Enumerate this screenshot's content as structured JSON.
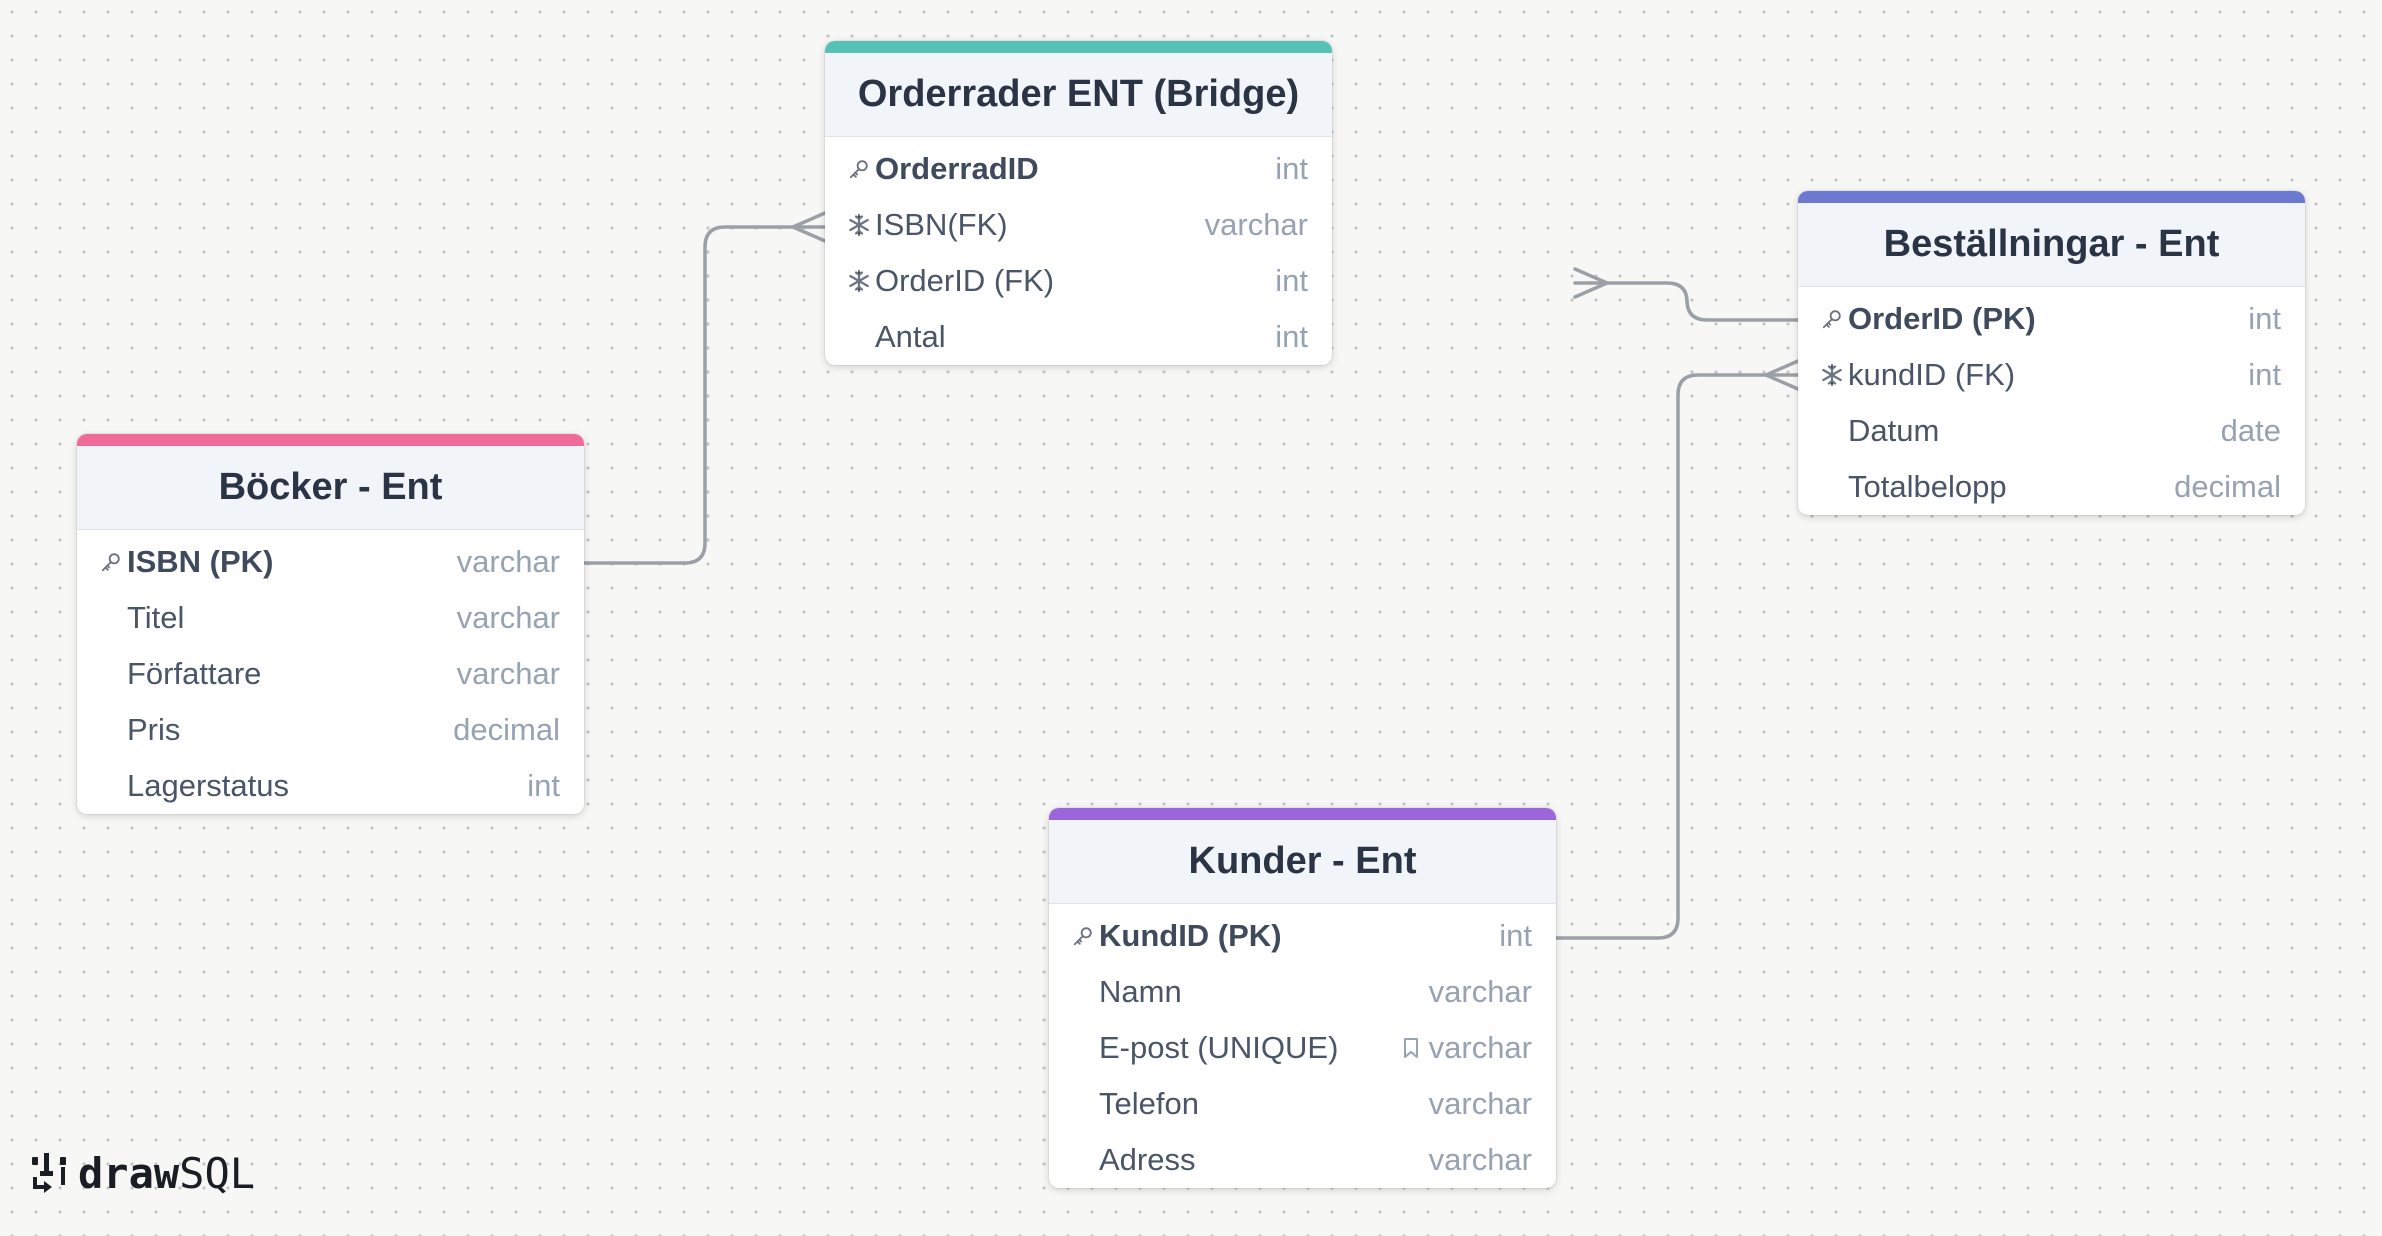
{
  "colors": {
    "orderrader": "#56c2b4",
    "bestallningar": "#6c79d1",
    "bocker": "#ef6b99",
    "kunder": "#9b65dc",
    "connector": "#9aa0a6"
  },
  "tables": {
    "orderrader": {
      "title": "Orderrader ENT (Bridge)",
      "fields": [
        {
          "name": "OrderradID",
          "type": "int",
          "icon": "key-icon"
        },
        {
          "name": "ISBN(FK)",
          "type": "varchar",
          "icon": "snowflake-icon"
        },
        {
          "name": "OrderID (FK)",
          "type": "int",
          "icon": "snowflake-icon"
        },
        {
          "name": "Antal",
          "type": "int",
          "icon": ""
        }
      ]
    },
    "bestallningar": {
      "title": "Beställningar - Ent",
      "fields": [
        {
          "name": "OrderID (PK)",
          "type": "int",
          "icon": "key-icon"
        },
        {
          "name": "kundID (FK)",
          "type": "int",
          "icon": "snowflake-icon"
        },
        {
          "name": "Datum",
          "type": "date",
          "icon": ""
        },
        {
          "name": "Totalbelopp",
          "type": "decimal",
          "icon": ""
        }
      ]
    },
    "bocker": {
      "title": "Böcker - Ent",
      "fields": [
        {
          "name": "ISBN (PK)",
          "type": "varchar",
          "icon": "key-icon"
        },
        {
          "name": "Titel",
          "type": "varchar",
          "icon": ""
        },
        {
          "name": "Författare",
          "type": "varchar",
          "icon": ""
        },
        {
          "name": "Pris",
          "type": "decimal",
          "icon": ""
        },
        {
          "name": "Lagerstatus",
          "type": "int",
          "icon": ""
        }
      ]
    },
    "kunder": {
      "title": "Kunder - Ent",
      "fields": [
        {
          "name": "KundID (PK)",
          "type": "int",
          "icon": "key-icon"
        },
        {
          "name": "Namn",
          "type": "varchar",
          "icon": ""
        },
        {
          "name": "E-post (UNIQUE)",
          "type": "varchar",
          "icon": "",
          "type_icon": "bookmark-icon"
        },
        {
          "name": "Telefon",
          "type": "varchar",
          "icon": ""
        },
        {
          "name": "Adress",
          "type": "varchar",
          "icon": ""
        }
      ]
    }
  },
  "relations": [
    {
      "from": "Böcker - Ent.ISBN (PK)",
      "to": "Orderrader ENT (Bridge).ISBN(FK)",
      "cardinality": "one-to-many"
    },
    {
      "from": "Beställningar - Ent.OrderID (PK)",
      "to": "Orderrader ENT (Bridge).OrderID (FK)",
      "cardinality": "one-to-many"
    },
    {
      "from": "Kunder - Ent.KundID (PK)",
      "to": "Beställningar - Ent.kundID (FK)",
      "cardinality": "one-to-many"
    }
  ],
  "brand": {
    "logo_bold": "draw",
    "logo_light": "SQL"
  }
}
